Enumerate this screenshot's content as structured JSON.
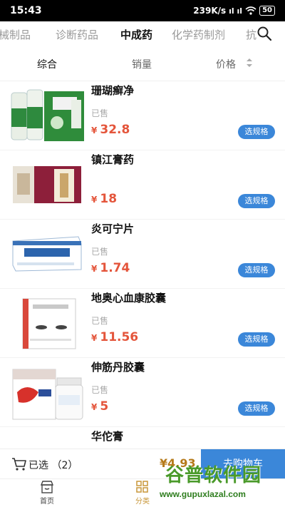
{
  "status_bar": {
    "time": "15:43",
    "speed": "239K/s",
    "signal": "ıl ıl",
    "battery": "50"
  },
  "tabs": [
    {
      "label": "械制品",
      "active": false
    },
    {
      "label": "诊断药品",
      "active": false
    },
    {
      "label": "中成药",
      "active": true
    },
    {
      "label": "化学药制剂",
      "active": false
    },
    {
      "label": "抗",
      "active": false
    }
  ],
  "sort": {
    "composite": "综合",
    "sales": "销量",
    "price": "价格"
  },
  "products": [
    {
      "name": "珊瑚癣净",
      "sold": "已售",
      "currency": "¥",
      "price": "32.8",
      "button": "选规格",
      "image": "green-medicine-box-image"
    },
    {
      "name": "镇江膏药",
      "sold": "",
      "currency": "¥",
      "price": "18",
      "button": "选规格",
      "image": "red-medicine-box-image"
    },
    {
      "name": "炎可宁片",
      "sold": "已售",
      "currency": "¥",
      "price": "1.74",
      "button": "选规格",
      "image": "blue-medicine-box-image"
    },
    {
      "name": "地奥心血康胶囊",
      "sold": "已售",
      "currency": "¥",
      "price": "11.56",
      "button": "选规格",
      "image": "white-medicine-box-image"
    },
    {
      "name": "伸筋丹胶囊",
      "sold": "已售",
      "currency": "¥",
      "price": "5",
      "button": "选规格",
      "image": "capsule-box-and-bottle-image"
    },
    {
      "name": "华佗膏",
      "sold": "",
      "currency": "",
      "price": "",
      "button": "",
      "image": ""
    }
  ],
  "cart": {
    "selected": "已选 （2）",
    "total": "¥4.93",
    "checkout": "去购物车"
  },
  "nav": {
    "home": "首页",
    "category": "分类"
  },
  "watermark": {
    "title": "谷普软件园",
    "url": "www.gupuxlazal.com"
  },
  "colors": {
    "accent_blue": "#3b87d9",
    "price_red": "#e4553b",
    "nav_active": "#c8973a"
  }
}
